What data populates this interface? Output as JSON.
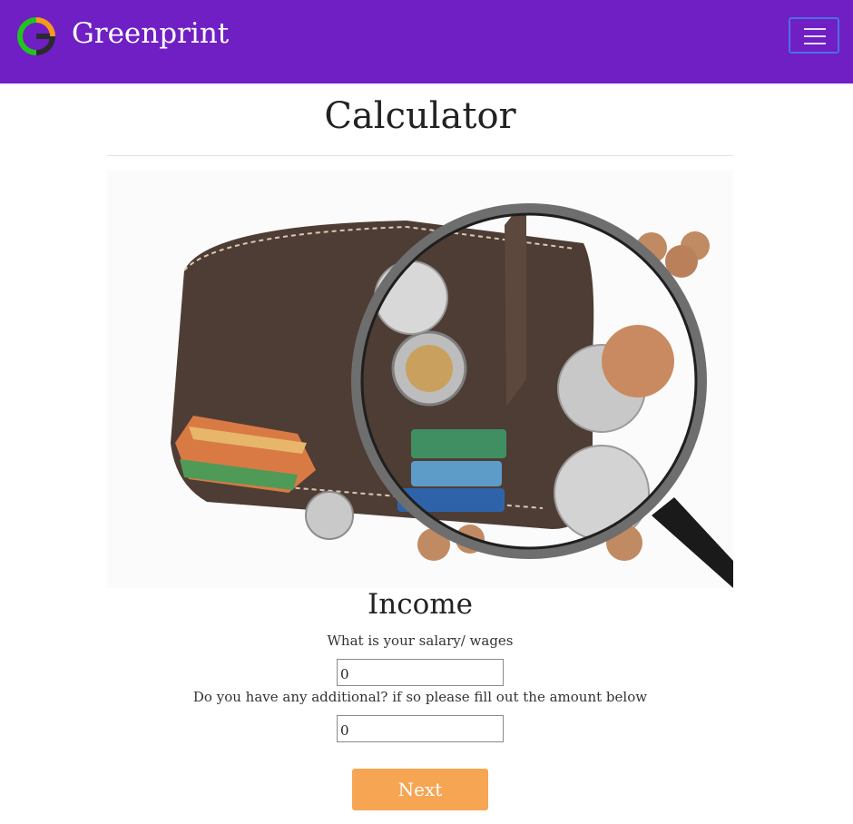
{
  "brand": {
    "name": "Greenprint",
    "logo_icon": "greenprint-logo-icon",
    "colors": {
      "green": "#22c21f",
      "orange": "#f59a1c",
      "dark": "#2b2a2e"
    }
  },
  "navbar": {
    "background": "#6f1fc3",
    "menu_icon": "hamburger-icon"
  },
  "page": {
    "title": "Calculator"
  },
  "hero": {
    "image": "wallet-magnifier-illustration"
  },
  "income": {
    "title": "Income",
    "salary_label": "What is your salary/ wages",
    "salary_value": "0",
    "additional_label": "Do you have any additional? if so please fill out the amount below",
    "additional_value": "0"
  },
  "actions": {
    "next_label": "Next",
    "next_color": "#f6a553"
  }
}
